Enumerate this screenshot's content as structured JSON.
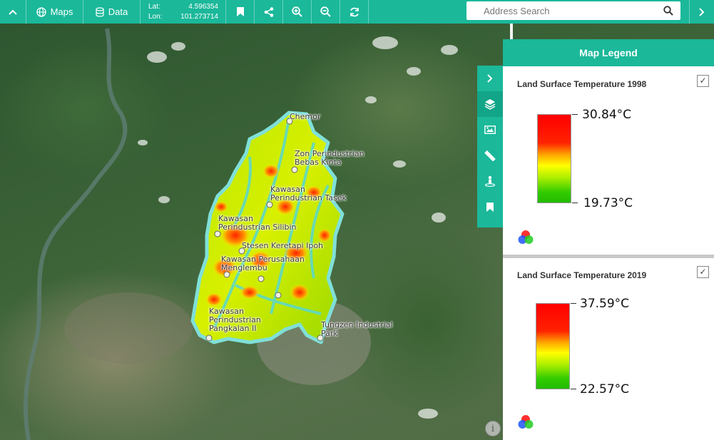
{
  "toolbar": {
    "maps_label": "Maps",
    "data_label": "Data",
    "lat_label": "Lat:",
    "lat_value": "4.596354",
    "lon_label": "Lon:",
    "lon_value": "101.273714",
    "search_placeholder": "Address Search",
    "accent_color": "#1bb89a"
  },
  "map": {
    "places": [
      {
        "name": "Chemor"
      },
      {
        "name": "Zon Perindustrian\nBebas Kinta"
      },
      {
        "name": "Kawasan\nPerindustrian Tasek"
      },
      {
        "name": "Kawasan\nPerindustrian Silibin"
      },
      {
        "name": "Stesen Keretapi Ipoh"
      },
      {
        "name": "Kawasan Perusahaan\nMenglembu"
      },
      {
        "name": "Kawasan\nPerindustrian\nPangkalan II"
      },
      {
        "name": "Tungzen Industrial\nPark"
      }
    ]
  },
  "legend": {
    "title": "Map Legend",
    "items": [
      {
        "title": "Land Surface Temperature 1998",
        "max": "30.84°C",
        "min": "19.73°C",
        "checked": "✓"
      },
      {
        "title": "Land Surface Temperature 2019",
        "max": "37.59°C",
        "min": "22.57°C",
        "checked": "✓"
      }
    ]
  },
  "tools": [
    "collapse-panel-icon",
    "layers-icon",
    "basemap-icon",
    "measure-icon",
    "street-view-icon",
    "bookmark-icon"
  ]
}
